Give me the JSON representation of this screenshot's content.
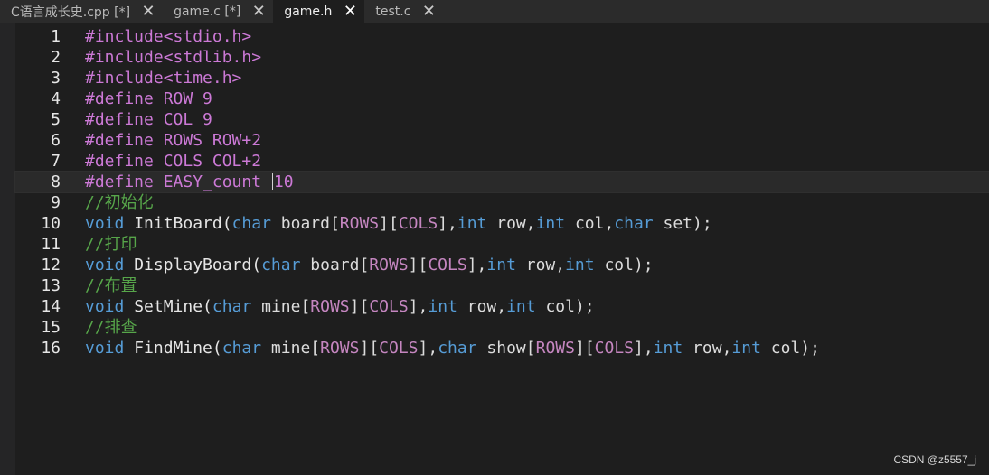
{
  "tabs": [
    {
      "label": "C语言成长史.cpp [*]",
      "close": "✕",
      "active": false
    },
    {
      "label": "game.c [*]",
      "close": "✕",
      "active": false
    },
    {
      "label": "game.h",
      "close": "✕",
      "active": true
    },
    {
      "label": "test.c",
      "close": "✕",
      "active": false
    }
  ],
  "editor": {
    "current_line": 8,
    "lines": [
      {
        "n": "1",
        "parts": [
          {
            "t": "#include<stdio.h>",
            "c": "pp"
          }
        ]
      },
      {
        "n": "2",
        "parts": [
          {
            "t": "#include<stdlib.h>",
            "c": "pp"
          }
        ]
      },
      {
        "n": "3",
        "parts": [
          {
            "t": "#include<time.h>",
            "c": "pp"
          }
        ]
      },
      {
        "n": "4",
        "parts": [
          {
            "t": "#define",
            "c": "pp"
          },
          {
            "t": " ROW 9",
            "c": "pp"
          }
        ]
      },
      {
        "n": "5",
        "parts": [
          {
            "t": "#define",
            "c": "pp"
          },
          {
            "t": " COL 9",
            "c": "pp"
          }
        ]
      },
      {
        "n": "6",
        "parts": [
          {
            "t": "#define",
            "c": "pp"
          },
          {
            "t": " ROWS ROW+2",
            "c": "pp"
          }
        ]
      },
      {
        "n": "7",
        "parts": [
          {
            "t": "#define",
            "c": "pp"
          },
          {
            "t": " COLS COL+2",
            "c": "pp"
          }
        ]
      },
      {
        "n": "8",
        "parts": [
          {
            "t": "#define",
            "c": "pp"
          },
          {
            "t": " EASY_count ",
            "c": "pp"
          },
          {
            "t": "|caret|",
            "c": "caret"
          },
          {
            "t": "10",
            "c": "pp"
          }
        ]
      },
      {
        "n": "9",
        "parts": [
          {
            "t": "//初始化",
            "c": "cm"
          }
        ]
      },
      {
        "n": "10",
        "parts": [
          {
            "t": "void",
            "c": "kw"
          },
          {
            "t": " InitBoard(",
            "c": "fn"
          },
          {
            "t": "char",
            "c": "kw"
          },
          {
            "t": " board[",
            "c": "id"
          },
          {
            "t": "ROWS",
            "c": "mac"
          },
          {
            "t": "][",
            "c": "id"
          },
          {
            "t": "COLS",
            "c": "mac"
          },
          {
            "t": "],",
            "c": "id"
          },
          {
            "t": "int",
            "c": "kw"
          },
          {
            "t": " row,",
            "c": "id"
          },
          {
            "t": "int",
            "c": "kw"
          },
          {
            "t": " col,",
            "c": "id"
          },
          {
            "t": "char",
            "c": "kw"
          },
          {
            "t": " set);",
            "c": "id"
          }
        ]
      },
      {
        "n": "11",
        "parts": [
          {
            "t": "//打印",
            "c": "cm"
          }
        ]
      },
      {
        "n": "12",
        "parts": [
          {
            "t": "void",
            "c": "kw"
          },
          {
            "t": " DisplayBoard(",
            "c": "fn"
          },
          {
            "t": "char",
            "c": "kw"
          },
          {
            "t": " board[",
            "c": "id"
          },
          {
            "t": "ROWS",
            "c": "mac"
          },
          {
            "t": "][",
            "c": "id"
          },
          {
            "t": "COLS",
            "c": "mac"
          },
          {
            "t": "],",
            "c": "id"
          },
          {
            "t": "int",
            "c": "kw"
          },
          {
            "t": " row,",
            "c": "id"
          },
          {
            "t": "int",
            "c": "kw"
          },
          {
            "t": " col);",
            "c": "id"
          }
        ]
      },
      {
        "n": "13",
        "parts": [
          {
            "t": "//布置",
            "c": "cm"
          }
        ]
      },
      {
        "n": "14",
        "parts": [
          {
            "t": "void",
            "c": "kw"
          },
          {
            "t": " SetMine(",
            "c": "fn"
          },
          {
            "t": "char",
            "c": "kw"
          },
          {
            "t": " mine[",
            "c": "id"
          },
          {
            "t": "ROWS",
            "c": "mac"
          },
          {
            "t": "][",
            "c": "id"
          },
          {
            "t": "COLS",
            "c": "mac"
          },
          {
            "t": "],",
            "c": "id"
          },
          {
            "t": "int",
            "c": "kw"
          },
          {
            "t": " row,",
            "c": "id"
          },
          {
            "t": "int",
            "c": "kw"
          },
          {
            "t": " col);",
            "c": "id"
          }
        ]
      },
      {
        "n": "15",
        "parts": [
          {
            "t": "//排查",
            "c": "cm"
          }
        ]
      },
      {
        "n": "16",
        "parts": [
          {
            "t": "void",
            "c": "kw"
          },
          {
            "t": " FindMine(",
            "c": "fn"
          },
          {
            "t": "char",
            "c": "kw"
          },
          {
            "t": " mine[",
            "c": "id"
          },
          {
            "t": "ROWS",
            "c": "mac"
          },
          {
            "t": "][",
            "c": "id"
          },
          {
            "t": "COLS",
            "c": "mac"
          },
          {
            "t": "],",
            "c": "id"
          },
          {
            "t": "char",
            "c": "kw"
          },
          {
            "t": " show[",
            "c": "id"
          },
          {
            "t": "ROWS",
            "c": "mac"
          },
          {
            "t": "][",
            "c": "id"
          },
          {
            "t": "COLS",
            "c": "mac"
          },
          {
            "t": "],",
            "c": "id"
          },
          {
            "t": "int",
            "c": "kw"
          },
          {
            "t": " row,",
            "c": "id"
          },
          {
            "t": "int",
            "c": "kw"
          },
          {
            "t": " col);",
            "c": "id"
          }
        ]
      }
    ]
  },
  "watermark": "CSDN @z5557_j"
}
